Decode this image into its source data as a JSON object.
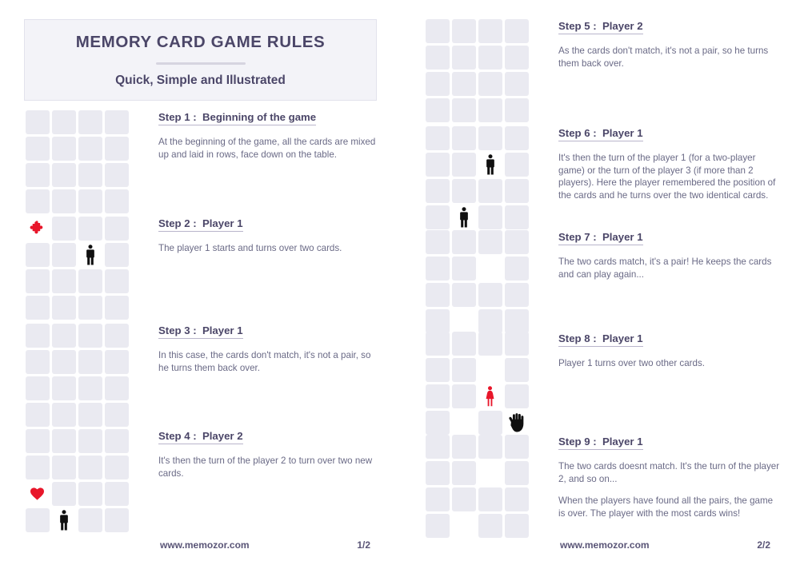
{
  "header": {
    "title": "MEMORY CARD GAME RULES",
    "subtitle": "Quick, Simple and Illustrated"
  },
  "left_column": {
    "footer": {
      "site": "www.memozor.com",
      "page": "1/2"
    },
    "steps": [
      {
        "title": "Step 1 :  Beginning of the game",
        "paragraphs": [
          "At the beginning of the game, all the cards are mixed up and laid in rows, face down on the table."
        ],
        "grid": {
          "rows": 4,
          "cols": 4,
          "cards": []
        }
      },
      {
        "title": "Step 2 :  Player 1",
        "paragraphs": [
          "The player 1 starts and turns over two cards."
        ],
        "grid": {
          "rows": 4,
          "cols": 4,
          "cards": [
            {
              "row": 1,
              "col": 1,
              "state": "flipped",
              "icon": "puzzle-piece-icon",
              "color": "#e8162a"
            },
            {
              "row": 2,
              "col": 3,
              "state": "flipped",
              "icon": "man-figure-icon",
              "color": "#101010"
            }
          ]
        }
      },
      {
        "title": "Step 3 :  Player 1",
        "paragraphs": [
          "In this case, the cards don't match, it's not a pair, so he turns them back over."
        ],
        "grid": {
          "rows": 4,
          "cols": 4,
          "cards": []
        }
      },
      {
        "title": "Step 4 :  Player 2",
        "paragraphs": [
          "It's then the turn of the player 2 to turn over two new cards."
        ],
        "grid": {
          "rows": 4,
          "cols": 4,
          "cards": [
            {
              "row": 3,
              "col": 1,
              "state": "flipped",
              "icon": "heart-icon",
              "color": "#e8162a"
            },
            {
              "row": 4,
              "col": 2,
              "state": "flipped",
              "icon": "man-figure-icon",
              "color": "#101010"
            }
          ]
        }
      }
    ]
  },
  "right_column": {
    "footer": {
      "site": "www.memozor.com",
      "page": "2/2"
    },
    "steps": [
      {
        "title": "Step 5 :  Player 2",
        "paragraphs": [
          "As the cards don't match, it's not a pair, so he turns them back over."
        ],
        "grid": {
          "rows": 4,
          "cols": 4,
          "cards": []
        }
      },
      {
        "title": "Step 6 :  Player 1",
        "paragraphs": [
          "It's then the turn of the player 1 (for a two-player game) or the turn of the player 3 (if more than 2 players). Here the player remembered the position of the cards and he turns over the two identical cards."
        ],
        "grid": {
          "rows": 4,
          "cols": 4,
          "cards": [
            {
              "row": 2,
              "col": 3,
              "state": "flipped",
              "icon": "man-figure-icon",
              "color": "#101010"
            },
            {
              "row": 4,
              "col": 2,
              "state": "flipped",
              "icon": "man-figure-icon",
              "color": "#101010"
            }
          ]
        }
      },
      {
        "title": "Step 7 :  Player 1",
        "paragraphs": [
          "The two cards match, it's a pair! He keeps the cards and can play again..."
        ],
        "grid": {
          "rows": 4,
          "cols": 4,
          "cards": [
            {
              "row": 2,
              "col": 3,
              "state": "removed",
              "icon": "",
              "color": ""
            },
            {
              "row": 4,
              "col": 2,
              "state": "removed",
              "icon": "",
              "color": ""
            }
          ]
        }
      },
      {
        "title": "Step 8 :  Player 1",
        "paragraphs": [
          "Player 1 turns over two other cards."
        ],
        "grid": {
          "rows": 4,
          "cols": 4,
          "cards": [
            {
              "row": 2,
              "col": 3,
              "state": "removed",
              "icon": "",
              "color": ""
            },
            {
              "row": 4,
              "col": 2,
              "state": "removed",
              "icon": "",
              "color": ""
            },
            {
              "row": 3,
              "col": 3,
              "state": "flipped",
              "icon": "woman-figure-icon",
              "color": "#e8162a"
            },
            {
              "row": 4,
              "col": 4,
              "state": "flipped",
              "icon": "hand-icon",
              "color": "#101010"
            }
          ]
        }
      },
      {
        "title": "Step 9 :  Player 1",
        "paragraphs": [
          "The two cards doesnt match. It's the turn of the player 2, and so on...",
          "When the players have found all the pairs, the game is over. The player with the most cards wins!"
        ],
        "grid": {
          "rows": 4,
          "cols": 4,
          "cards": [
            {
              "row": 2,
              "col": 3,
              "state": "removed",
              "icon": "",
              "color": ""
            },
            {
              "row": 4,
              "col": 2,
              "state": "removed",
              "icon": "",
              "color": ""
            }
          ]
        }
      }
    ]
  },
  "layout": {
    "left_step_tops": [
      136,
      269,
      403,
      535
    ],
    "right_step_tops": [
      22,
      156,
      286,
      413,
      542
    ],
    "colors": {
      "card_back": "#eaeaf1",
      "card_face": "#ffffff",
      "accent_red": "#e8162a",
      "heading": "#4b4668",
      "body_text": "#6a6a86",
      "panel_bg": "#f3f3f8"
    }
  }
}
